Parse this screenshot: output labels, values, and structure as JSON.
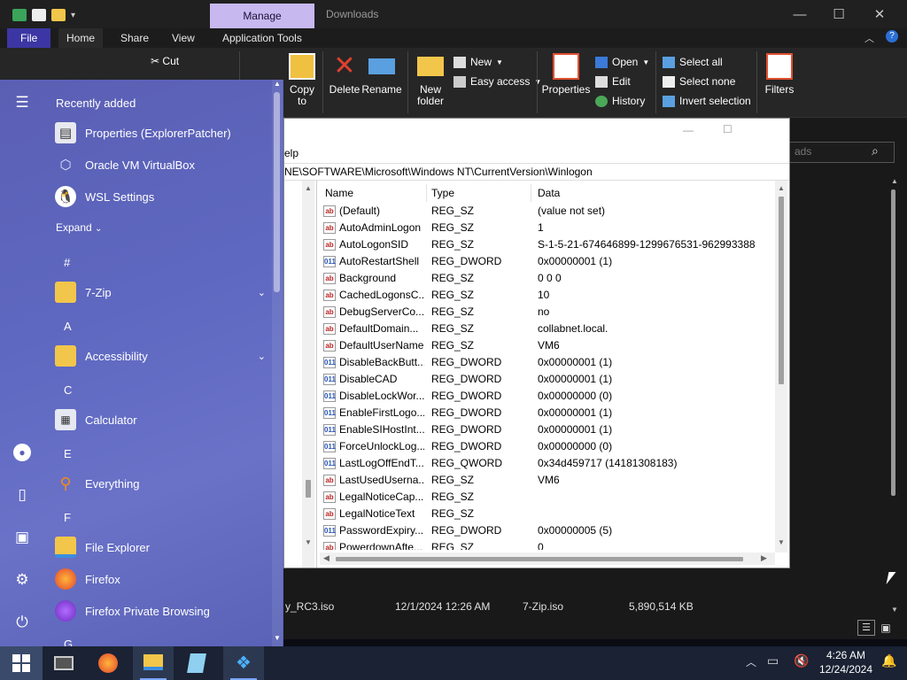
{
  "explorer": {
    "window_title": "Downloads",
    "manage_tab": "Manage",
    "tabs": [
      "File",
      "Home",
      "Share",
      "View",
      "Application Tools"
    ],
    "ribbon": {
      "cut": "Cut",
      "copy_to": "Copy\nto",
      "delete": "Delete",
      "rename": "Rename",
      "new_folder": "New\nfolder",
      "new": "New",
      "easy_access": "Easy access",
      "properties": "Properties",
      "open": "Open",
      "edit": "Edit",
      "history": "History",
      "select_all": "Select all",
      "select_none": "Select none",
      "invert_selection": "Invert selection",
      "filters": "Filters"
    },
    "search_placeholder": "ads",
    "file_row": {
      "name": "y_RC3.iso",
      "date": "12/1/2024 12:26 AM",
      "type": "7-Zip.iso",
      "size": "5,890,514 KB"
    }
  },
  "regedit": {
    "menu_partial": "elp",
    "path": "NE\\SOFTWARE\\Microsoft\\Windows NT\\CurrentVersion\\Winlogon",
    "columns": [
      "Name",
      "Type",
      "Data"
    ],
    "rows": [
      {
        "name": "(Default)",
        "type": "REG_SZ",
        "data": "(value not set)",
        "kind": "ab"
      },
      {
        "name": "AutoAdminLogon",
        "type": "REG_SZ",
        "data": "1",
        "kind": "ab"
      },
      {
        "name": "AutoLogonSID",
        "type": "REG_SZ",
        "data": "S-1-5-21-674646899-1299676531-962993388",
        "kind": "ab"
      },
      {
        "name": "AutoRestartShell",
        "type": "REG_DWORD",
        "data": "0x00000001 (1)",
        "kind": "bin"
      },
      {
        "name": "Background",
        "type": "REG_SZ",
        "data": "0 0 0",
        "kind": "ab"
      },
      {
        "name": "CachedLogonsC...",
        "type": "REG_SZ",
        "data": "10",
        "kind": "ab"
      },
      {
        "name": "DebugServerCo...",
        "type": "REG_SZ",
        "data": "no",
        "kind": "ab"
      },
      {
        "name": "DefaultDomain...",
        "type": "REG_SZ",
        "data": "collabnet.local.",
        "kind": "ab"
      },
      {
        "name": "DefaultUserName",
        "type": "REG_SZ",
        "data": "VM6",
        "kind": "ab"
      },
      {
        "name": "DisableBackButt...",
        "type": "REG_DWORD",
        "data": "0x00000001 (1)",
        "kind": "bin"
      },
      {
        "name": "DisableCAD",
        "type": "REG_DWORD",
        "data": "0x00000001 (1)",
        "kind": "bin"
      },
      {
        "name": "DisableLockWor...",
        "type": "REG_DWORD",
        "data": "0x00000000 (0)",
        "kind": "bin"
      },
      {
        "name": "EnableFirstLogo...",
        "type": "REG_DWORD",
        "data": "0x00000001 (1)",
        "kind": "bin"
      },
      {
        "name": "EnableSIHostInt...",
        "type": "REG_DWORD",
        "data": "0x00000001 (1)",
        "kind": "bin"
      },
      {
        "name": "ForceUnlockLog...",
        "type": "REG_DWORD",
        "data": "0x00000000 (0)",
        "kind": "bin"
      },
      {
        "name": "LastLogOffEndT...",
        "type": "REG_QWORD",
        "data": "0x34d459717 (14181308183)",
        "kind": "bin"
      },
      {
        "name": "LastUsedUserna...",
        "type": "REG_SZ",
        "data": "VM6",
        "kind": "ab"
      },
      {
        "name": "LegalNoticeCap...",
        "type": "REG_SZ",
        "data": "",
        "kind": "ab"
      },
      {
        "name": "LegalNoticeText",
        "type": "REG_SZ",
        "data": "",
        "kind": "ab"
      },
      {
        "name": "PasswordExpiry...",
        "type": "REG_DWORD",
        "data": "0x00000005 (5)",
        "kind": "bin"
      },
      {
        "name": "PowerdownAfte...",
        "type": "REG_SZ",
        "data": "0",
        "kind": "ab"
      }
    ]
  },
  "start_menu": {
    "recently_added": "Recently added",
    "recent": [
      "Properties (ExplorerPatcher)",
      "Oracle VM VirtualBox",
      "WSL Settings"
    ],
    "expand": "Expand",
    "letters": {
      "hash": "#",
      "a": "A",
      "c": "C",
      "e": "E",
      "f": "F",
      "g": "G"
    },
    "apps": {
      "zip": "7-Zip",
      "accessibility": "Accessibility",
      "calculator": "Calculator",
      "everything": "Everything",
      "file_explorer": "File Explorer",
      "firefox": "Firefox",
      "firefox_private": "Firefox Private Browsing"
    }
  },
  "taskbar": {
    "time": "4:26 AM",
    "date": "12/24/2024"
  }
}
